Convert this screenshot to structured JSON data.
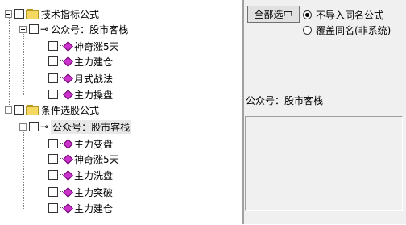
{
  "tree": {
    "groups": [
      {
        "label": "技术指标公式",
        "author": "公众号：股市客栈",
        "items": [
          "神奇涨5天",
          "主力建仓",
          "月式战法",
          "主力操盘"
        ]
      },
      {
        "label": "条件选股公式",
        "author": "公众号：股市客栈",
        "items": [
          "主力变盘",
          "神奇涨5天",
          "主力洗盘",
          "主力突破",
          "主力建仓"
        ]
      }
    ]
  },
  "panel": {
    "select_all_label": "全部选中",
    "radio_options": [
      {
        "label": "不导入同名公式",
        "selected": true
      },
      {
        "label": "覆盖同名(非系统)",
        "selected": false
      }
    ],
    "info_label": "公众号：股市客栈"
  },
  "icons": {
    "group": "folder-icon",
    "author": "key-icon",
    "formula": "formula-diamond-icon"
  },
  "colors": {
    "folder": "#f5d860",
    "formula_icon": "#cc33cc"
  }
}
